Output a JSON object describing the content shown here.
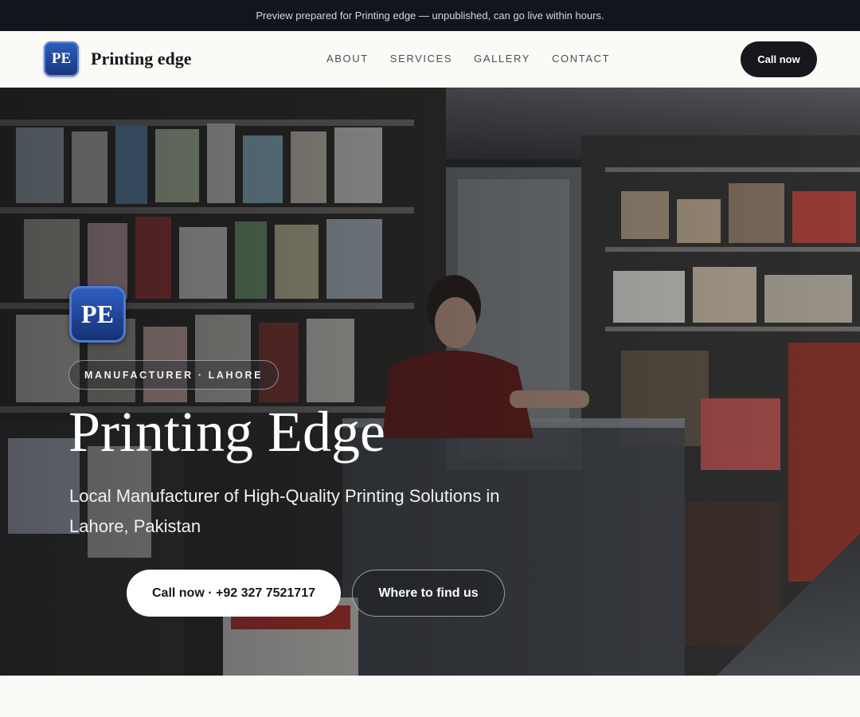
{
  "preview_banner": "Preview prepared for Printing edge — unpublished, can go live within hours.",
  "header": {
    "logo_initials": "PE",
    "brand_name": "Printing edge",
    "nav": [
      "ABOUT",
      "SERVICES",
      "GALLERY",
      "CONTACT"
    ],
    "call_label": "Call now"
  },
  "hero": {
    "logo_initials": "PE",
    "tag": "MANUFACTURER · LAHORE",
    "title": "Printing Edge",
    "subtitle": "Local Manufacturer of High-Quality Printing Solutions in Lahore, Pakistan",
    "primary_button": "Call now · +92 327 7521717",
    "secondary_button": "Where to find us"
  },
  "colors": {
    "dark": "#16181d",
    "logo_blue": "#1f4aa3",
    "page_bg": "#faf9f6"
  }
}
